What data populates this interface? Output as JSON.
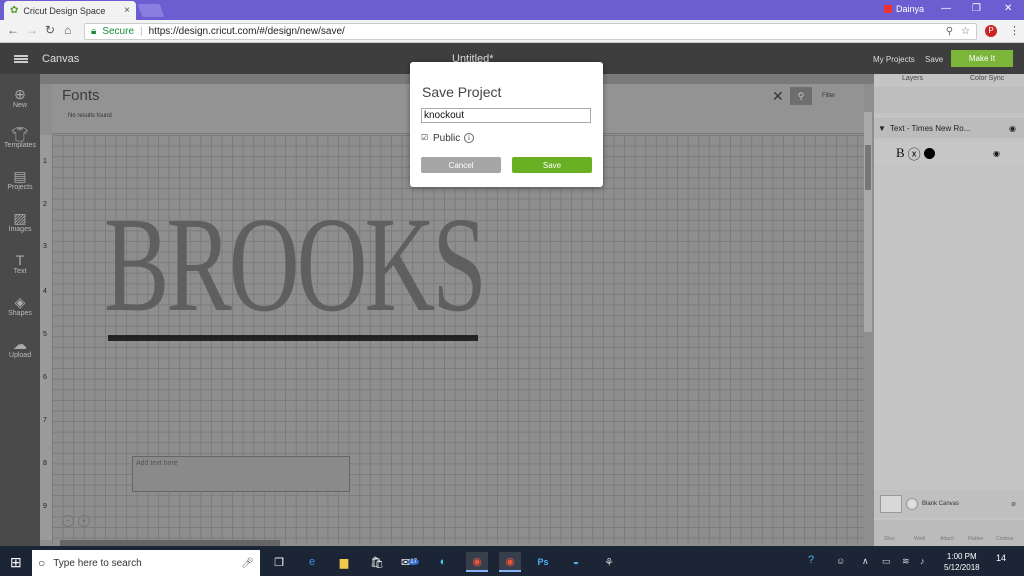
{
  "browser": {
    "tab_title": "Cricut Design Space",
    "tab_close": "×",
    "user_name": "Dainya",
    "window_controls": [
      "—",
      "❐",
      "✕"
    ],
    "secure_label": "Secure",
    "url": "https://design.cricut.com/#/design/new/save/"
  },
  "app_header": {
    "canvas_label": "Canvas",
    "doc_title": "Untitled*",
    "my_projects": "My Projects",
    "save": "Save",
    "make_it": "Make It"
  },
  "sidebar": {
    "items": [
      {
        "label": "New",
        "icon": "plus-circle-icon"
      },
      {
        "label": "Templates",
        "icon": "shirt-icon"
      },
      {
        "label": "Projects",
        "icon": "projects-icon"
      },
      {
        "label": "Images",
        "icon": "image-icon"
      },
      {
        "label": "Text",
        "icon": "text-icon"
      },
      {
        "label": "Shapes",
        "icon": "shapes-icon"
      },
      {
        "label": "Upload",
        "icon": "cloud-upload-icon"
      }
    ]
  },
  "fonts_panel": {
    "title": "Fonts",
    "no_results": "No results found",
    "filter": "Filter"
  },
  "canvas": {
    "ruler_numbers": [
      "1",
      "2",
      "3",
      "4",
      "5",
      "6",
      "7",
      "8",
      "9"
    ],
    "design_text": "BROOKS",
    "text_placeholder": "Add text here"
  },
  "right_panel": {
    "tabs": [
      "Layers",
      "Color Sync"
    ],
    "layer_name": "Text - Times New Ro...",
    "sublayer_glyph": "B",
    "blank_canvas": "Blank Canvas",
    "bottom_icons": [
      "Slice",
      "Weld",
      "Attach",
      "Flatten",
      "Contour"
    ]
  },
  "dialog": {
    "title": "Save Project",
    "input_value": "knockout",
    "public_label": "Public",
    "public_checked": true,
    "cancel": "Cancel",
    "save": "Save"
  },
  "taskbar": {
    "search_placeholder": "Type here to search",
    "time": "1:00 PM",
    "date": "5/12/2018",
    "notifications": "14",
    "badge_count": "17"
  },
  "colors": {
    "chrome_titlebar": "#6c5ed1",
    "make_it_green": "#7bb63a",
    "save_green": "#6ab023",
    "cancel_gray": "#a6a6a6",
    "taskbar": "#1c2535"
  }
}
